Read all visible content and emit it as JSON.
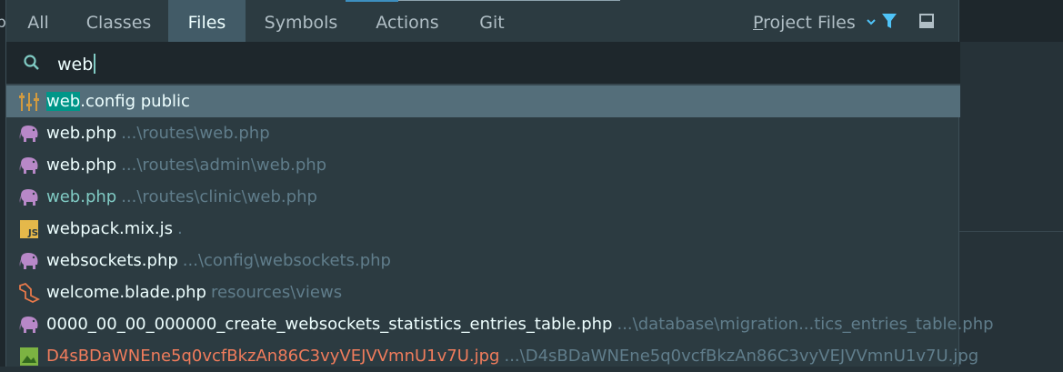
{
  "tabs": [
    {
      "label": "All",
      "active": false
    },
    {
      "label": "Classes",
      "active": false
    },
    {
      "label": "Files",
      "active": true
    },
    {
      "label": "Symbols",
      "active": false
    },
    {
      "label": "Actions",
      "active": false
    },
    {
      "label": "Git",
      "active": false
    }
  ],
  "scope": {
    "label_first": "P",
    "label_rest": "roject Files"
  },
  "search": {
    "value": "web"
  },
  "results": [
    {
      "match": "web",
      "name_rest": ".config public",
      "path": "",
      "icon": "config-sliders-icon",
      "selected": true
    },
    {
      "match": "",
      "name_rest": "web.php",
      "path": "...\\routes\\web.php",
      "icon": "php-elephant-icon"
    },
    {
      "match": "",
      "name_rest": "web.php",
      "path": "...\\routes\\admin\\web.php",
      "icon": "php-elephant-icon"
    },
    {
      "match": "",
      "name_rest": "web.php",
      "path": "...\\routes\\clinic\\web.php",
      "icon": "php-elephant-icon",
      "teal": true
    },
    {
      "match": "",
      "name_rest": "webpack.mix.js",
      "path": ".",
      "icon": "javascript-icon"
    },
    {
      "match": "",
      "name_rest": "websockets.php",
      "path": "...\\config\\websockets.php",
      "icon": "php-elephant-icon"
    },
    {
      "match": "",
      "name_rest": "welcome.blade.php",
      "path": "resources\\views",
      "icon": "laravel-blade-icon"
    },
    {
      "match": "",
      "name_rest": "0000_00_00_000000_create_websockets_statistics_entries_table.php",
      "path": "...\\database\\migration...tics_entries_table.php",
      "icon": "php-elephant-icon"
    },
    {
      "match": "",
      "name_rest": "D4sBDaWNEne5q0vcfBkzAn86C3vyVEJVVmnU1v7U.jpg",
      "path": "...\\D4sBDaWNEne5q0vcfBkzAn86C3vyVEJVVmnU1v7U.jpg",
      "icon": "image-file-icon",
      "orange": true
    }
  ],
  "colors": {
    "accent": "#80cbc4",
    "selection": "#546e7a",
    "highlight": "#009688",
    "active_tab": "#425b67"
  }
}
